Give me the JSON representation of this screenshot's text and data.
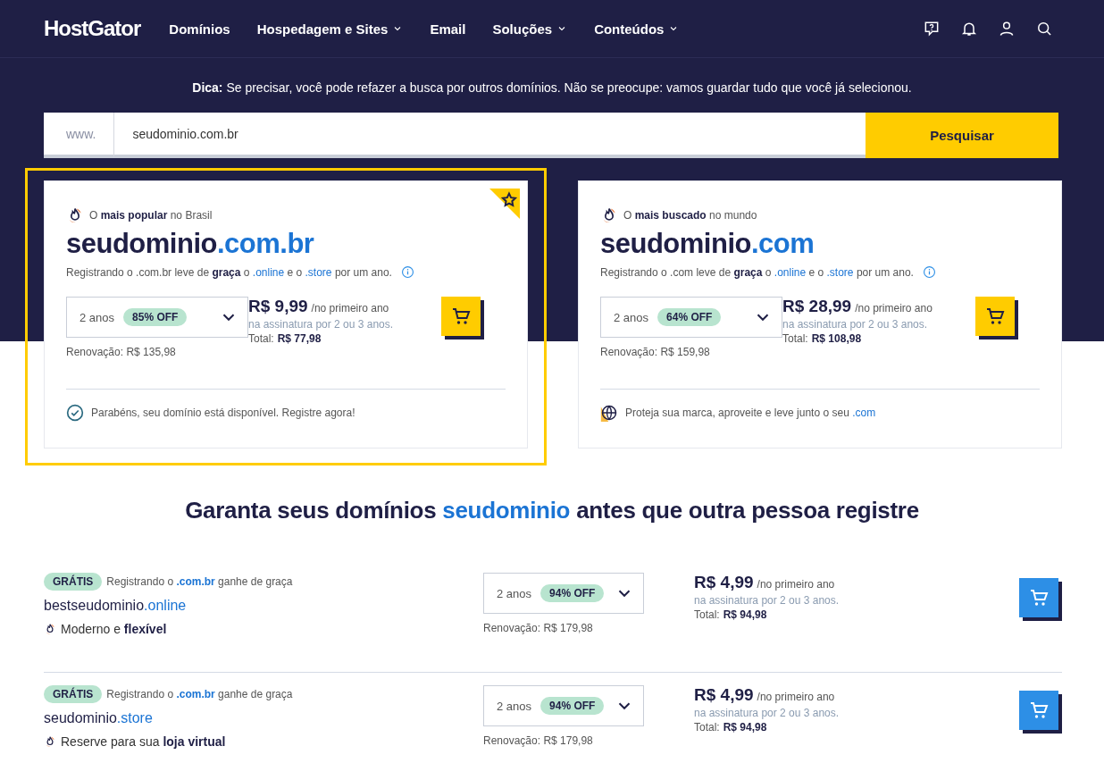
{
  "nav": {
    "logo": "HostGator",
    "items": [
      {
        "label": "Domínios",
        "dropdown": false
      },
      {
        "label": "Hospedagem e Sites",
        "dropdown": true
      },
      {
        "label": "Email",
        "dropdown": false
      },
      {
        "label": "Soluções",
        "dropdown": true
      },
      {
        "label": "Conteúdos",
        "dropdown": true
      }
    ]
  },
  "tip": "**Dica:** Se precisar, você pode refazer a busca por outros domínios. Não se preocupe: vamos guardar tudo que você já selecionou.",
  "search": {
    "prefix": "www.",
    "value": "seudominio.com.br",
    "button": "Pesquisar"
  },
  "featured": [
    {
      "highlighted": true,
      "starred": true,
      "tagline": "O **mais popular** no Brasil",
      "name": "seudominio",
      "extension": ".com.br",
      "note": [
        {
          "kind": "plain",
          "text": "Registrando o .com.br leve de "
        },
        {
          "kind": "bold",
          "text": "graça"
        },
        {
          "kind": "plain",
          "text": " o "
        },
        {
          "kind": "link",
          "text": ".online"
        },
        {
          "kind": "plain",
          "text": " e o "
        },
        {
          "kind": "link",
          "text": ".store"
        },
        {
          "kind": "plain",
          "text": " por um ano."
        }
      ],
      "period": "2 anos",
      "discount": "85% OFF",
      "renewal": "Renovação: R$ 135,98",
      "price": "R$ 9,99",
      "price_unit": "/no primeiro ano",
      "price_note": "na assinatura por 2 ou 3 anos.",
      "total_label": "Total:",
      "total": "R$ 77,98",
      "footer": {
        "kind": "check",
        "parts": [
          {
            "kind": "plain",
            "text": "Parabéns, seu domínio está disponível. Registre agora!"
          }
        ]
      }
    },
    {
      "highlighted": false,
      "starred": false,
      "tagline": "O **mais buscado** no mundo",
      "name": "seudominio",
      "extension": ".com",
      "note": [
        {
          "kind": "plain",
          "text": "Registrando o .com leve de "
        },
        {
          "kind": "bold",
          "text": "graça"
        },
        {
          "kind": "plain",
          "text": " o "
        },
        {
          "kind": "link",
          "text": ".online"
        },
        {
          "kind": "plain",
          "text": " e o "
        },
        {
          "kind": "link",
          "text": ".store"
        },
        {
          "kind": "plain",
          "text": " por um ano."
        }
      ],
      "period": "2 anos",
      "discount": "64% OFF",
      "renewal": "Renovação: R$ 159,98",
      "price": "R$ 28,99",
      "price_unit": "/no primeiro ano",
      "price_note": "na assinatura por 2 ou 3 anos.",
      "total_label": "Total:",
      "total": "R$ 108,98",
      "footer": {
        "kind": "globe",
        "parts": [
          {
            "kind": "plain",
            "text": "Proteja sua marca, aproveite e leve junto o seu "
          },
          {
            "kind": "link",
            "text": ".com"
          }
        ]
      }
    }
  ],
  "heading": [
    {
      "kind": "plain",
      "text": "Garanta seus domínios "
    },
    {
      "kind": "link",
      "text": "seudominio"
    },
    {
      "kind": "plain",
      "text": " antes que outra pessoa registre"
    }
  ],
  "suggestions": [
    {
      "badge": "GRÁTIS",
      "note": [
        {
          "kind": "plain",
          "text": "Registrando o "
        },
        {
          "kind": "linkbold",
          "text": ".com.br"
        },
        {
          "kind": "plain",
          "text": " ganhe de graça"
        }
      ],
      "name": "bestseudominio",
      "extension": ".online",
      "feature": "Moderno e **flexível**",
      "period": "2 anos",
      "discount": "94% OFF",
      "renewal": "Renovação: R$ 179,98",
      "price": "R$ 4,99",
      "price_unit": "/no primeiro ano",
      "price_note": "na assinatura por 2 ou 3 anos.",
      "total_label": "Total:",
      "total": "R$ 94,98"
    },
    {
      "badge": "GRÁTIS",
      "note": [
        {
          "kind": "plain",
          "text": "Registrando o "
        },
        {
          "kind": "linkbold",
          "text": ".com.br"
        },
        {
          "kind": "plain",
          "text": " ganhe de graça"
        }
      ],
      "name": "seudominio",
      "extension": ".store",
      "feature": "Reserve para sua **loja virtual**",
      "period": "2 anos",
      "discount": "94% OFF",
      "renewal": "Renovação: R$ 179,98",
      "price": "R$ 4,99",
      "price_unit": "/no primeiro ano",
      "price_note": "na assinatura por 2 ou 3 anos.",
      "total_label": "Total:",
      "total": "R$ 94,98"
    }
  ]
}
